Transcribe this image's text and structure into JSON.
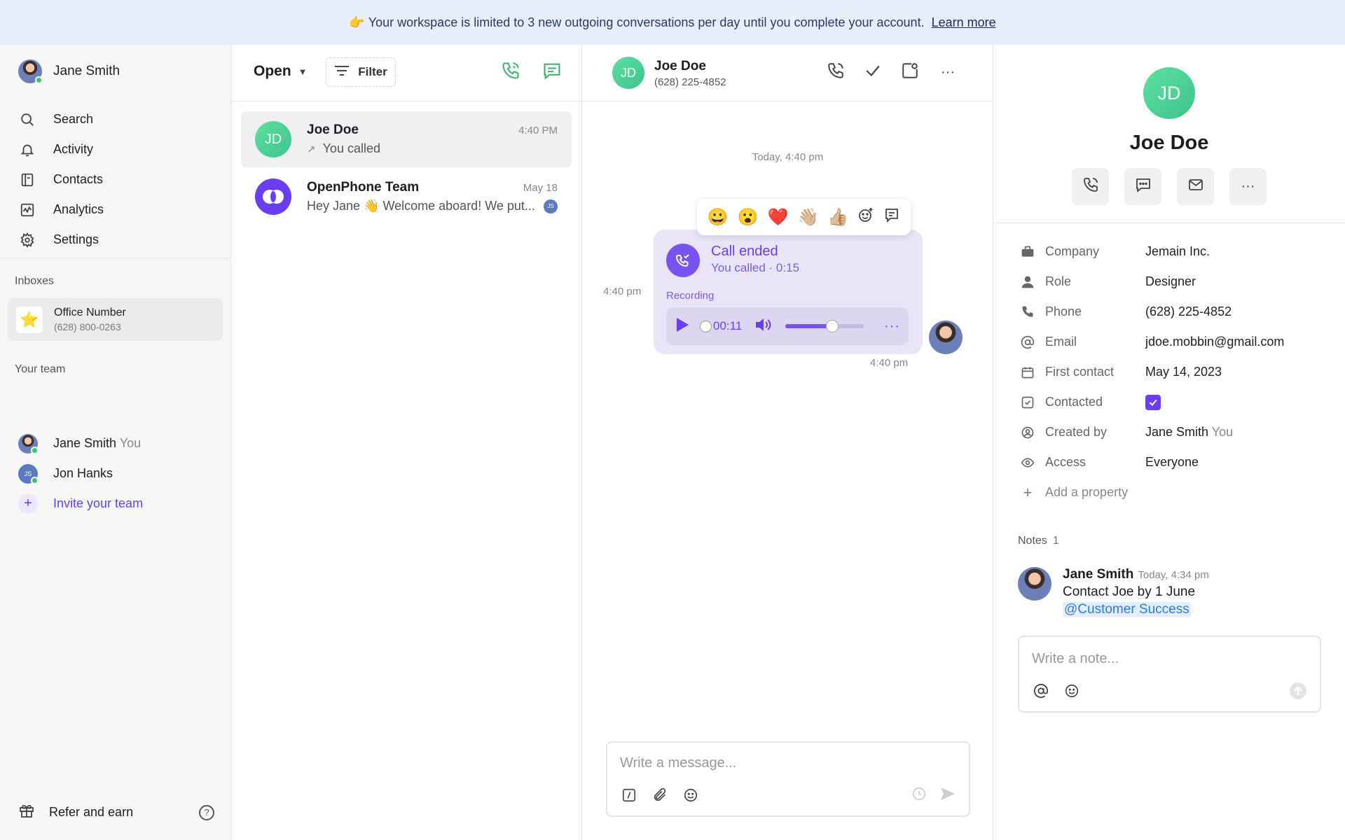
{
  "banner": {
    "emoji": "👉",
    "text": "Your workspace is limited to 3 new outgoing conversations per day until you complete your account.",
    "link": "Learn more"
  },
  "sidebar": {
    "user_name": "Jane Smith",
    "nav": [
      {
        "label": "Search",
        "icon": "search-icon"
      },
      {
        "label": "Activity",
        "icon": "bell-icon"
      },
      {
        "label": "Contacts",
        "icon": "contacts-book-icon"
      },
      {
        "label": "Analytics",
        "icon": "analytics-icon"
      },
      {
        "label": "Settings",
        "icon": "gear-icon"
      }
    ],
    "inboxes_label": "Inboxes",
    "inbox": {
      "name": "Office Number",
      "number": "(628) 800-0263",
      "icon": "⭐"
    },
    "team_label": "Your team",
    "team": [
      {
        "name": "Jane Smith",
        "suffix": "You"
      },
      {
        "name": "Jon Hanks",
        "initials": "JS"
      }
    ],
    "invite_label": "Invite your team",
    "refer_label": "Refer and earn",
    "help_glyph": "?"
  },
  "convlist": {
    "status_label": "Open",
    "filter_label": "Filter",
    "items": [
      {
        "avatar": "JD",
        "name": "Joe Doe",
        "time": "4:40 PM",
        "snippet_icon": "↗",
        "snippet": "You called"
      },
      {
        "name": "OpenPhone Team",
        "time": "May 18",
        "snippet": "Hey Jane 👋 Welcome aboard! We put...",
        "badge": "JS"
      }
    ]
  },
  "chat": {
    "avatar": "JD",
    "name": "Joe Doe",
    "phone": "(628) 225-4852",
    "date_divider": "Today, 4:40 pm",
    "reactions": [
      "😀",
      "😮",
      "❤️",
      "👋🏼",
      "👍🏼"
    ],
    "call": {
      "title": "Call ended",
      "subtitle": "You called · 0:15",
      "recording_label": "Recording",
      "position": "00:11",
      "volume_level": 0.6,
      "more": "···"
    },
    "time_left": "4:40 pm",
    "time_right": "4:40 pm",
    "composer_placeholder": "Write a message..."
  },
  "contact": {
    "avatar": "JD",
    "name": "Joe Doe",
    "properties": [
      {
        "key": "Company",
        "value": "Jemain Inc.",
        "icon": "briefcase-icon"
      },
      {
        "key": "Role",
        "value": "Designer",
        "icon": "person-icon"
      },
      {
        "key": "Phone",
        "value": "(628) 225-4852",
        "icon": "phone-icon"
      },
      {
        "key": "Email",
        "value": "jdoe.mobbin@gmail.com",
        "icon": "at-icon"
      },
      {
        "key": "First contact",
        "value": "May 14, 2023",
        "icon": "calendar-icon"
      },
      {
        "key": "Contacted",
        "value": "",
        "icon": "check-square-icon",
        "checked": true
      },
      {
        "key": "Created by",
        "value": "Jane Smith",
        "value_suffix": "You",
        "icon": "user-circle-icon"
      },
      {
        "key": "Access",
        "value": "Everyone",
        "icon": "eye-icon"
      }
    ],
    "add_property_label": "Add a property",
    "notes_label": "Notes",
    "notes_count": "1",
    "note": {
      "author": "Jane Smith",
      "time": "Today, 4:34 pm",
      "text": "Contact Joe by 1 June",
      "mention": "@Customer Success"
    },
    "note_placeholder": "Write a note..."
  }
}
